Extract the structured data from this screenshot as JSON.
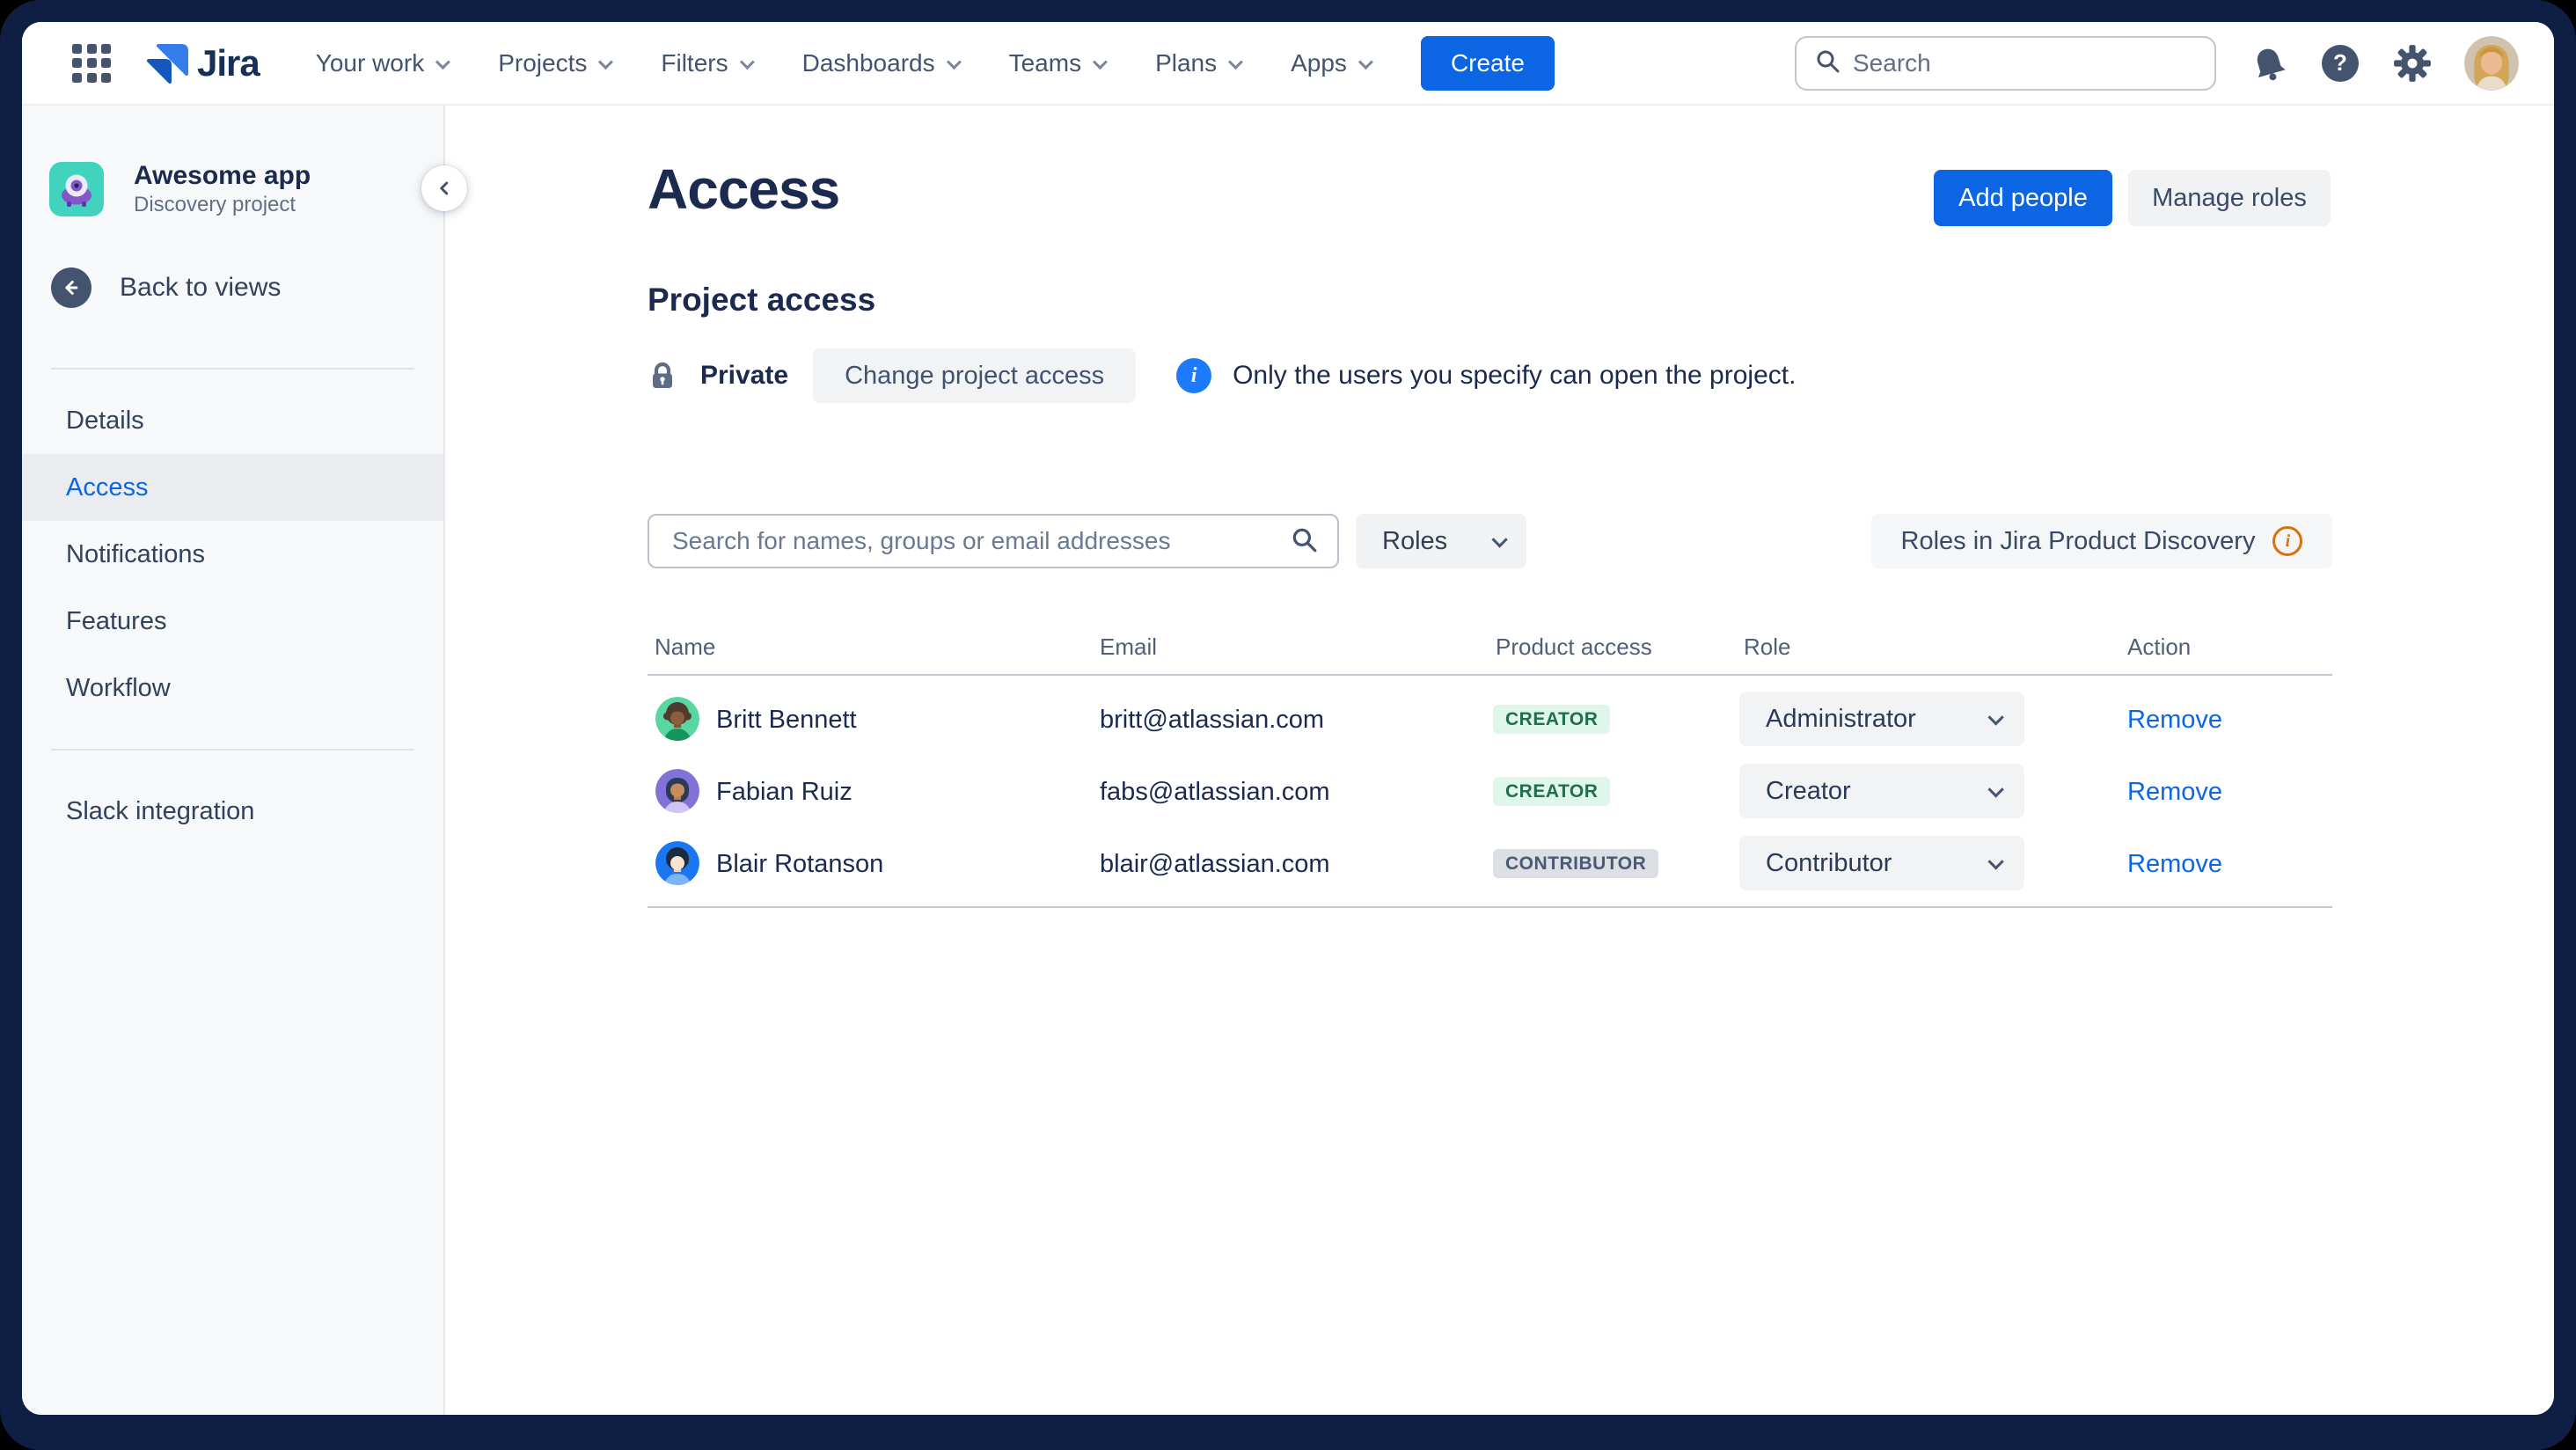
{
  "topnav": {
    "logo_text": "Jira",
    "items": [
      {
        "label": "Your work"
      },
      {
        "label": "Projects"
      },
      {
        "label": "Filters"
      },
      {
        "label": "Dashboards"
      },
      {
        "label": "Teams"
      },
      {
        "label": "Plans"
      },
      {
        "label": "Apps"
      }
    ],
    "create_label": "Create",
    "search_placeholder": "Search",
    "help_glyph": "?"
  },
  "sidebar": {
    "project": {
      "name": "Awesome app",
      "type": "Discovery project"
    },
    "back_label": "Back to views",
    "menu": [
      {
        "label": "Details",
        "active": false
      },
      {
        "label": "Access",
        "active": true
      },
      {
        "label": "Notifications",
        "active": false
      },
      {
        "label": "Features",
        "active": false
      },
      {
        "label": "Workflow",
        "active": false
      }
    ],
    "footer_menu": [
      {
        "label": "Slack integration"
      }
    ]
  },
  "main": {
    "title": "Access",
    "add_people_label": "Add people",
    "manage_roles_label": "Manage roles",
    "section_title": "Project access",
    "privacy": {
      "level": "Private",
      "change_label": "Change project access",
      "info_glyph": "i",
      "info_text": "Only the users you specify can open the project."
    },
    "filter": {
      "search_placeholder": "Search for names, groups or email addresses",
      "roles_dropdown_label": "Roles",
      "roles_info_label": "Roles in Jira Product Discovery",
      "info_glyph": "i"
    },
    "table": {
      "headers": [
        "Name",
        "Email",
        "Product access",
        "Role",
        "Action"
      ],
      "rows": [
        {
          "name": "Britt Bennett",
          "email": "britt@atlassian.com",
          "product_access": "CREATOR",
          "access_variant": "green",
          "role": "Administrator",
          "action": "Remove"
        },
        {
          "name": "Fabian Ruiz",
          "email": "fabs@atlassian.com",
          "product_access": "CREATOR",
          "access_variant": "green",
          "role": "Creator",
          "action": "Remove"
        },
        {
          "name": "Blair Rotanson",
          "email": "blair@atlassian.com",
          "product_access": "CONTRIBUTOR",
          "access_variant": "gray",
          "role": "Contributor",
          "action": "Remove"
        }
      ]
    }
  },
  "colors": {
    "accent_blue": "#0C66E4",
    "frame_navy": "#0F1F44",
    "sidebar_bg": "#F7F8F9",
    "selected_item_bg": "#EBECF0",
    "badge_green_bg": "#DFF7EA",
    "badge_green_text": "#216E4E",
    "badge_gray_bg": "#DCDFE4",
    "badge_gray_text": "#4A5A75",
    "info_blue": "#1D7AFC",
    "info_orange": "#D97008",
    "project_icon_teal": "#41D3BD"
  }
}
